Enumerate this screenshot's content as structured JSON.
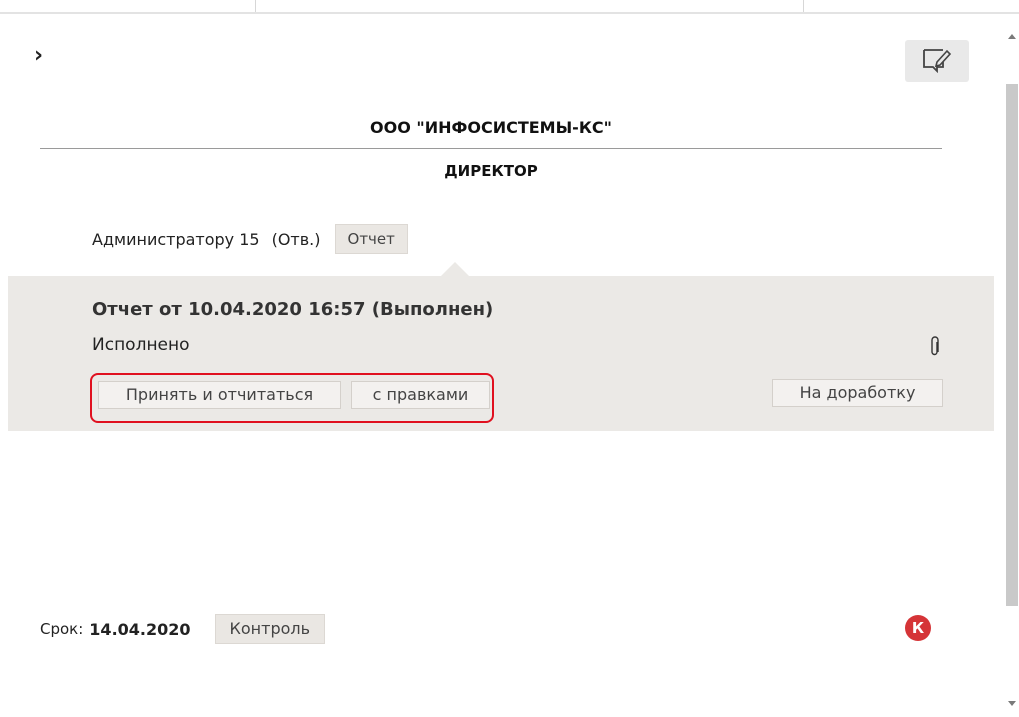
{
  "header": {
    "organization": "ООО \"ИНФОСИСТЕМЫ-КС\"",
    "position": "ДИРЕКТОР"
  },
  "assignee": {
    "name": "Администратору 15",
    "role": "(Отв.)",
    "report_tag": "Отчет"
  },
  "report": {
    "header": "Отчет от 10.04.2020 16:57 (Выполнен)",
    "status_text": "Исполнено",
    "accept_button": "Принять и отчитаться",
    "corrections_button": "с правками",
    "rework_button": "На доработку"
  },
  "deadline": {
    "label": "Срок:",
    "date": "14.04.2020",
    "control_tag": "Контроль"
  },
  "badge": {
    "letter": "К",
    "color": "#d53437"
  },
  "icons": {
    "expand": "chevron-right-icon",
    "edit": "edit-note-icon",
    "attachment": "paperclip-icon"
  },
  "colors": {
    "highlight": "#e0101f",
    "panel_bg": "#ebe9e6"
  }
}
